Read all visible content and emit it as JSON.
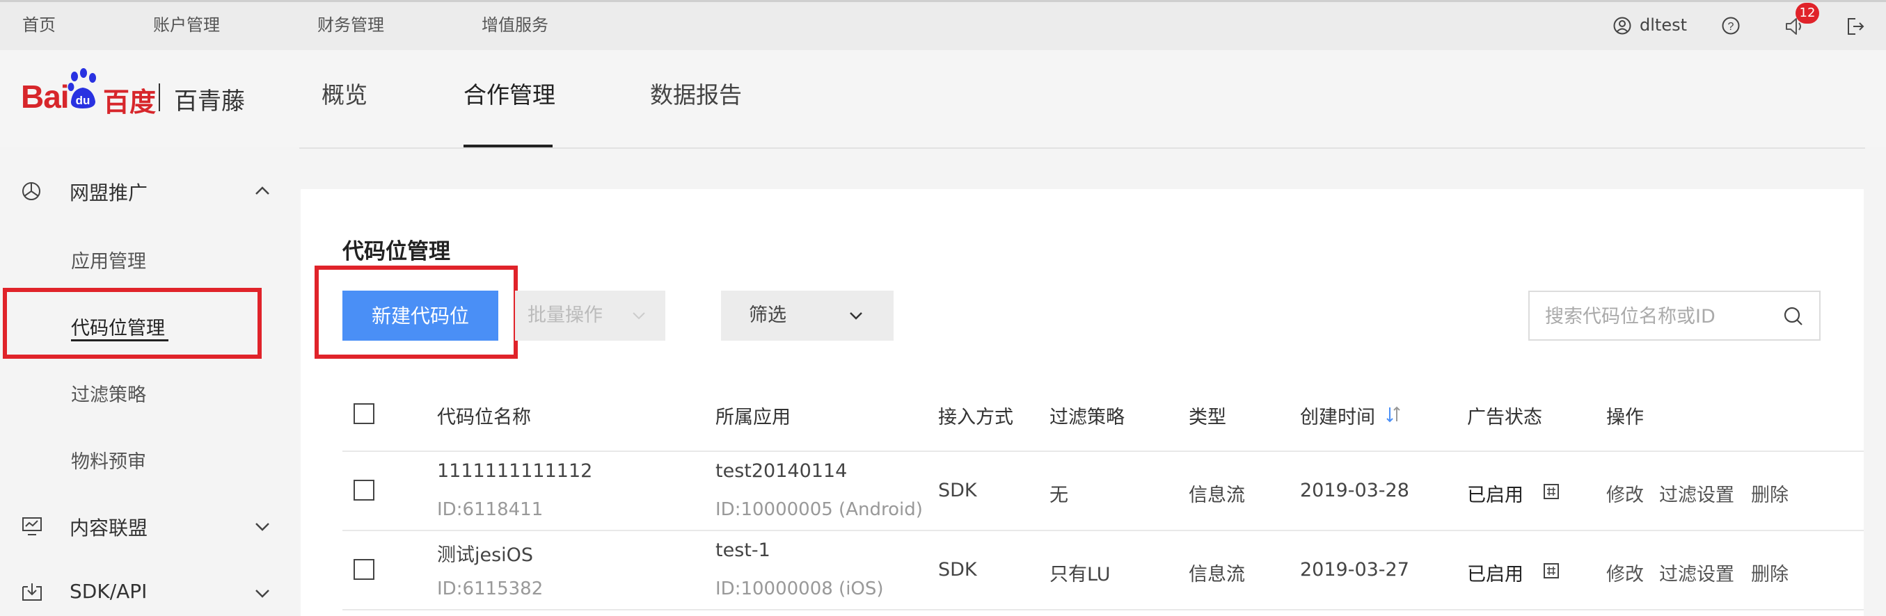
{
  "topnav": {
    "items": [
      "首页",
      "账户管理",
      "财务管理",
      "增值服务"
    ],
    "username": "dltest",
    "notification_count": "12"
  },
  "logo": {
    "bai": "Bai",
    "du": "du",
    "cn": "百度",
    "product": "百青藤"
  },
  "main_tabs": [
    {
      "label": "概览",
      "active": false
    },
    {
      "label": "合作管理",
      "active": true
    },
    {
      "label": "数据报告",
      "active": false
    }
  ],
  "sidebar": {
    "groups": [
      {
        "label": "网盟推广",
        "icon": "pie-icon",
        "expanded": true,
        "items": [
          {
            "label": "应用管理"
          },
          {
            "label": "代码位管理",
            "active": true
          },
          {
            "label": "过滤策略"
          },
          {
            "label": "物料预审"
          }
        ]
      },
      {
        "label": "内容联盟",
        "icon": "monitor-icon",
        "expanded": false
      },
      {
        "label": "SDK/API",
        "icon": "download-box-icon",
        "expanded": false
      }
    ]
  },
  "page": {
    "title": "代码位管理",
    "new_button": "新建代码位",
    "batch_label": "批量操作",
    "filter_label": "筛选",
    "search_placeholder": "搜索代码位名称或ID"
  },
  "table": {
    "headers": [
      "代码位名称",
      "所属应用",
      "接入方式",
      "过滤策略",
      "类型",
      "创建时间",
      "广告状态",
      "操作"
    ],
    "rows": [
      {
        "name": "1111111111112",
        "id": "ID:6118411",
        "app": "test20140114",
        "app_id": "ID:10000005 (Android)",
        "access": "SDK",
        "filter": "无",
        "type": "信息流",
        "created": "2019-03-28",
        "status": "已启用",
        "ops": [
          "修改",
          "过滤设置",
          "删除"
        ]
      },
      {
        "name": "测试jesiOS",
        "id": "ID:6115382",
        "app": "test-1",
        "app_id": "ID:10000008 (iOS)",
        "access": "SDK",
        "filter": "只有LU",
        "type": "信息流",
        "created": "2019-03-27",
        "status": "已启用",
        "ops": [
          "修改",
          "过滤设置",
          "删除"
        ]
      }
    ]
  },
  "colors": {
    "brand_red": "#d7262b",
    "primary_blue": "#4a8ff6",
    "highlight_red": "#e0232a"
  }
}
